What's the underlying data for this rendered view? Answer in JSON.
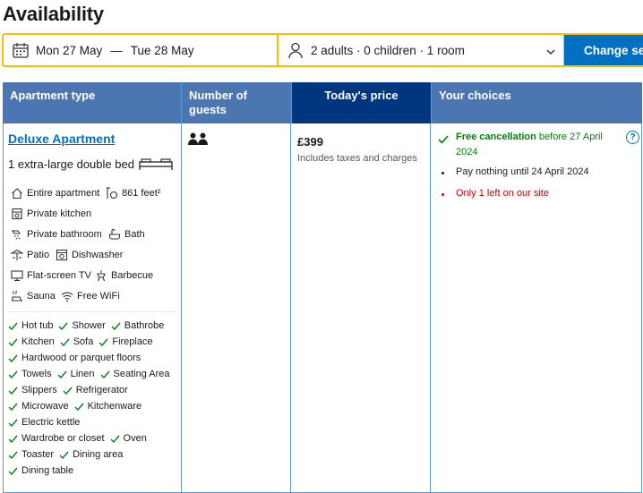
{
  "page": {
    "title": "Availability"
  },
  "search": {
    "dates": {
      "checkin": "Mon 27 May",
      "separator": "—",
      "checkout": "Tue 28 May"
    },
    "guests": "2 adults · 0 children · 1 room",
    "button_label": "Change search"
  },
  "table": {
    "headers": {
      "type": "Apartment type",
      "guests": "Number of guests",
      "price": "Today's price",
      "choices": "Your choices"
    }
  },
  "room": {
    "name": "Deluxe Apartment",
    "bed": "1 extra-large double bed",
    "facilities": [
      {
        "icon": "house-icon",
        "label": "Entire apartment"
      },
      {
        "icon": "area-icon",
        "label": "861 feet²"
      },
      {
        "icon": "kitchen-icon",
        "label": "Private kitchen"
      },
      {
        "icon": "shower-icon",
        "label": "Private bathroom"
      },
      {
        "icon": "bath-icon",
        "label": "Bath"
      },
      {
        "icon": "patio-icon",
        "label": "Patio"
      },
      {
        "icon": "dishwasher-icon",
        "label": "Dishwasher"
      },
      {
        "icon": "tv-icon",
        "label": "Flat-screen TV"
      },
      {
        "icon": "barbecue-icon",
        "label": "Barbecue"
      },
      {
        "icon": "sauna-icon",
        "label": "Sauna"
      },
      {
        "icon": "wifi-icon",
        "label": "Free WiFi"
      }
    ],
    "amenities": [
      [
        "Hot tub",
        "Shower",
        "Bathrobe"
      ],
      [
        "Kitchen",
        "Sofa",
        "Fireplace"
      ],
      [
        "Hardwood or parquet floors"
      ],
      [
        "Towels",
        "Linen",
        "Seating Area"
      ],
      [
        "Slippers",
        "Refrigerator"
      ],
      [
        "Microwave",
        "Kitchenware"
      ],
      [
        "Electric kettle"
      ],
      [
        "Wardrobe or closet",
        "Oven"
      ],
      [
        "Toaster",
        "Dining area"
      ],
      [
        "Dining table"
      ]
    ]
  },
  "price": {
    "amount": "£399",
    "note": "Includes taxes and charges"
  },
  "choices": {
    "cancel_bold": "Free cancellation",
    "cancel_rest": " before 27 April 2024",
    "pay": "Pay nothing until 24 April 2024",
    "left": "Only 1 left on our site",
    "help": "?"
  },
  "colors": {
    "brand_blue": "#0071c2",
    "header_blue": "#4c76b2",
    "price_header": "#003580",
    "accent_yellow": "#febb02",
    "green": "#008009",
    "red": "#cc0000"
  }
}
